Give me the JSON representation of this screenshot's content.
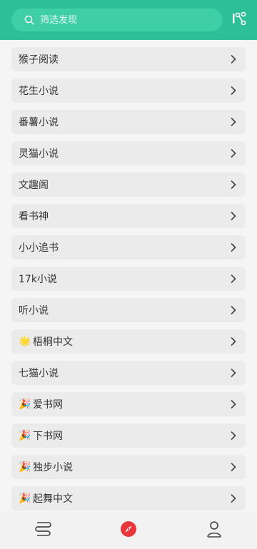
{
  "search": {
    "placeholder": "筛选发现"
  },
  "header": {
    "icon": "flow-icon"
  },
  "list": {
    "items": [
      {
        "label": "猴子阅读",
        "emoji": ""
      },
      {
        "label": "花生小说",
        "emoji": ""
      },
      {
        "label": "番薯小说",
        "emoji": ""
      },
      {
        "label": "灵猫小说",
        "emoji": ""
      },
      {
        "label": "文趣阁",
        "emoji": ""
      },
      {
        "label": "看书神",
        "emoji": ""
      },
      {
        "label": "小小追书",
        "emoji": ""
      },
      {
        "label": "17k小说",
        "emoji": ""
      },
      {
        "label": "听小说",
        "emoji": ""
      },
      {
        "label": "梧桐中文",
        "emoji": "🌟"
      },
      {
        "label": "七猫小说",
        "emoji": ""
      },
      {
        "label": "爱书网",
        "emoji": "🎉"
      },
      {
        "label": "下书网",
        "emoji": "🎉"
      },
      {
        "label": "独步小说",
        "emoji": "🎉"
      },
      {
        "label": "起舞中文",
        "emoji": "🎉"
      }
    ]
  },
  "tabbar": {
    "tabs": [
      {
        "name": "bookshelf",
        "icon": "bookshelf-icon"
      },
      {
        "name": "discover",
        "icon": "compass-icon",
        "active_color": "#e8383d"
      },
      {
        "name": "profile",
        "icon": "person-icon"
      }
    ]
  },
  "colors": {
    "header": "#2dbf97",
    "search_bg": "#3fcfa7",
    "item_bg": "#ebebeb",
    "accent": "#e8383d"
  }
}
